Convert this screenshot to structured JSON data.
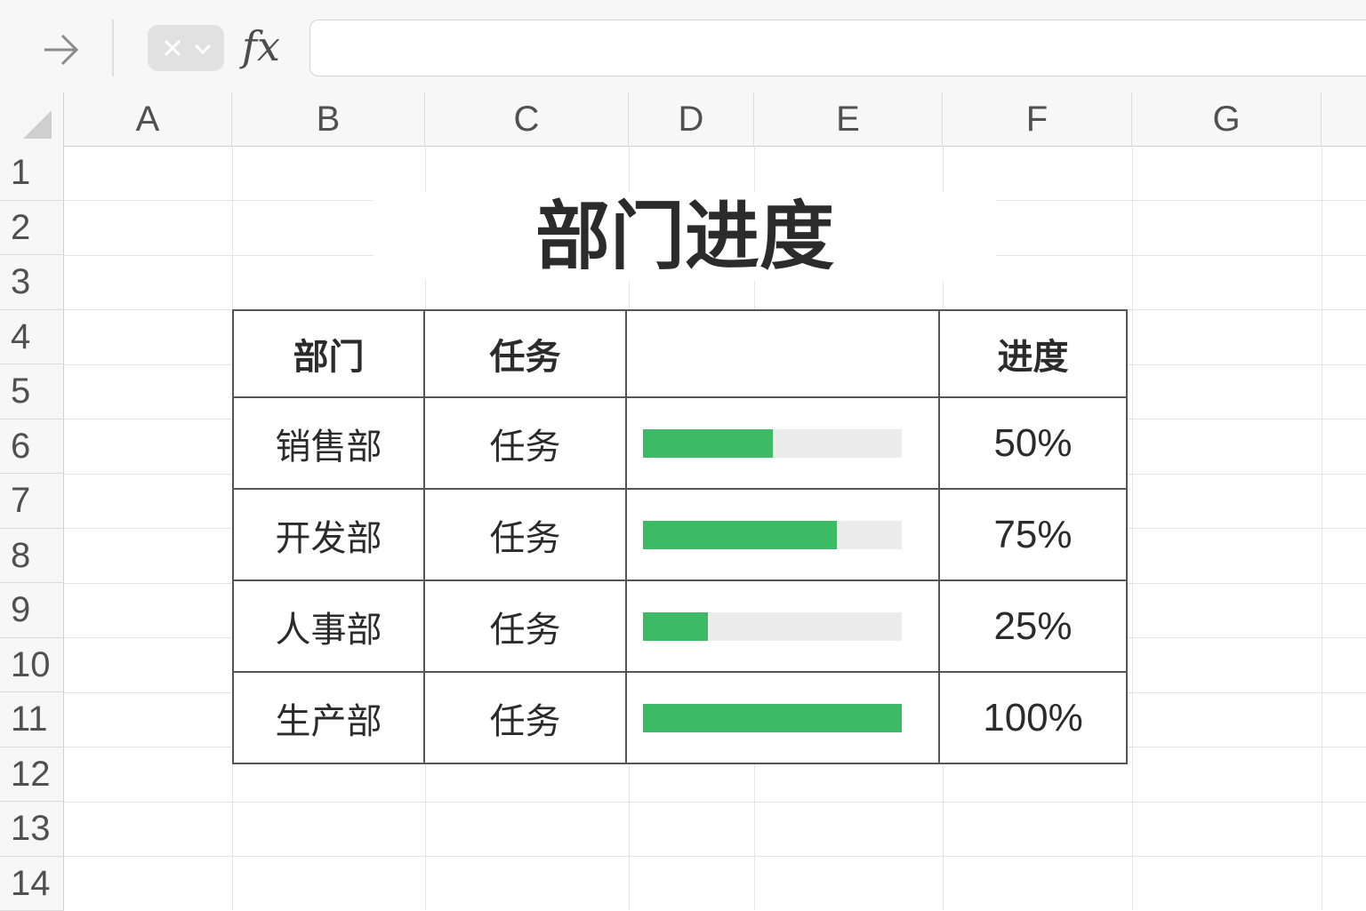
{
  "formula_bar": {
    "fx_label": "fx",
    "input_value": ""
  },
  "columns": [
    "A",
    "B",
    "C",
    "D",
    "E",
    "F",
    "G"
  ],
  "rows": [
    "1",
    "2",
    "3",
    "4",
    "5",
    "6",
    "7",
    "8",
    "9",
    "10",
    "11",
    "12",
    "13",
    "14"
  ],
  "sheet": {
    "title": "部门进度",
    "table": {
      "headers": [
        "部门",
        "任务",
        "",
        "进度"
      ],
      "rows": [
        {
          "department": "销售部",
          "task": "任务",
          "progress": 0.5,
          "percent_label": "50%"
        },
        {
          "department": "开发部",
          "task": "任务",
          "progress": 0.75,
          "percent_label": "75%"
        },
        {
          "department": "人事部",
          "task": "任务",
          "progress": 0.25,
          "percent_label": "25%"
        },
        {
          "department": "生产部",
          "task": "任务",
          "progress": 1.0,
          "percent_label": "100%"
        }
      ]
    }
  },
  "colors": {
    "progress_fill": "#3dba65",
    "progress_track": "#ececec"
  }
}
